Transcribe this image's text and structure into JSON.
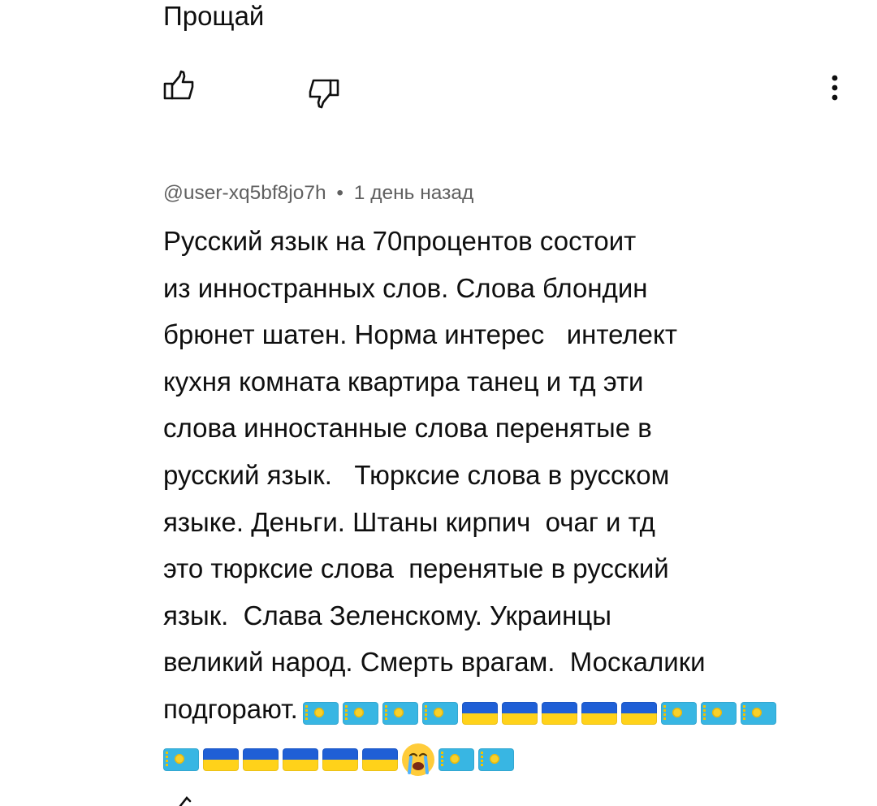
{
  "previous_comment": {
    "text": "Прощай",
    "actions": {
      "like_icon": "thumbs-up-icon",
      "dislike_icon": "thumbs-down-icon",
      "menu_icon": "more-vertical-icon"
    }
  },
  "comment": {
    "author": "@user-xq5bf8jo7h",
    "separator": "•",
    "time": "1 день назад",
    "lines": [
      "Русский язык на 70процентов состоит",
      "из инностранных слов. Слова блондин",
      "брюнет шатен. Норма интерес   интелект",
      "кухня комната квартира танец и тд эти",
      "слова инностанные слова перенятые в",
      "русский язык.   Тюрксие слова в русском",
      "языке. Деньги. Штаны кирпич  очаг и тд",
      "это тюрксие слова  перенятые в русский",
      "язык.  Слава Зеленскому. Украинцы",
      "великий народ. Смерть врагам.  Москалики",
      "подгорают."
    ],
    "emoji_row_1": [
      "flag-kz",
      "flag-kz",
      "flag-kz",
      "flag-kz",
      "flag-ua",
      "flag-ua",
      "flag-ua",
      "flag-ua",
      "flag-ua",
      "flag-kz",
      "flag-kz",
      "flag-kz"
    ],
    "emoji_row_2": [
      "flag-kz",
      "flag-ua",
      "flag-ua",
      "flag-ua",
      "flag-ua",
      "flag-ua",
      "crying-face",
      "flag-kz",
      "flag-kz"
    ]
  },
  "colors": {
    "text": "#0f0f0f",
    "meta": "#606060",
    "kz_blue": "#38b6e3",
    "ua_blue": "#1f5fd6",
    "ua_yellow": "#ffd21a"
  }
}
